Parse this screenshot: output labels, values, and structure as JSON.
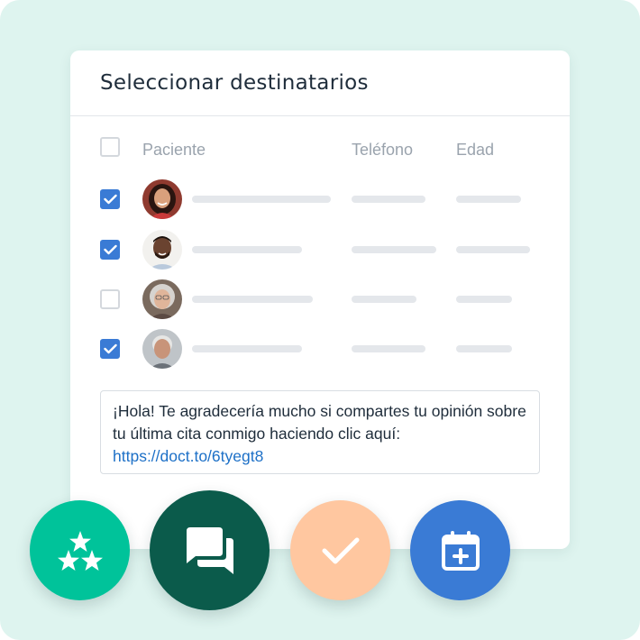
{
  "card": {
    "title": "Seleccionar destinatarios",
    "columns": {
      "patient": "Paciente",
      "phone": "Teléfono",
      "age": "Edad"
    }
  },
  "rows": [
    {
      "checked": true,
      "avatar": "avatar-woman-dark-hair"
    },
    {
      "checked": true,
      "avatar": "avatar-man-beard"
    },
    {
      "checked": false,
      "avatar": "avatar-older-woman"
    },
    {
      "checked": true,
      "avatar": "avatar-older-man"
    }
  ],
  "message": {
    "text": "¡Hola! Te agradecería mucho si compartes tu opinión sobre tu última cita conmigo haciendo clic aquí:",
    "link": "https://doct.to/6tyegt8"
  },
  "actions": [
    {
      "name": "reviews-stars-icon",
      "color": "#00c39a"
    },
    {
      "name": "chat-icon",
      "color": "#0b5b4b"
    },
    {
      "name": "checkmark-icon",
      "color": "#ffc7a0"
    },
    {
      "name": "calendar-add-icon",
      "color": "#3a7bd5"
    }
  ],
  "colors": {
    "background": "#def4ef",
    "accent_blue": "#3a7bd5",
    "link": "#1d70c7"
  }
}
